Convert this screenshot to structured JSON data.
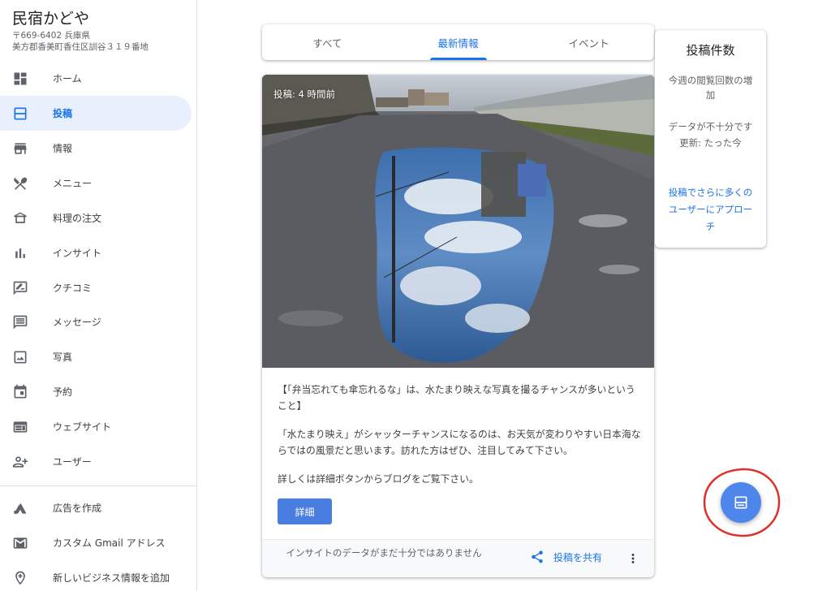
{
  "business": {
    "name": "民宿かどや",
    "address_line1": "〒669-6402 兵庫県",
    "address_line2": "美方郡香美町香住区訓谷３１９番地"
  },
  "sidebar": {
    "items": [
      {
        "label": "ホーム",
        "icon": "dashboard-icon"
      },
      {
        "label": "投稿",
        "icon": "post-icon",
        "active": true
      },
      {
        "label": "情報",
        "icon": "store-icon"
      },
      {
        "label": "メニュー",
        "icon": "utensils-icon"
      },
      {
        "label": "料理の注文",
        "icon": "food-order-icon"
      },
      {
        "label": "インサイト",
        "icon": "bar-chart-icon"
      },
      {
        "label": "クチコミ",
        "icon": "review-icon"
      },
      {
        "label": "メッセージ",
        "icon": "message-icon"
      },
      {
        "label": "写真",
        "icon": "photo-icon"
      },
      {
        "label": "予約",
        "icon": "calendar-icon"
      },
      {
        "label": "ウェブサイト",
        "icon": "website-icon"
      },
      {
        "label": "ユーザー",
        "icon": "add-user-icon"
      }
    ],
    "bottom_items": [
      {
        "label": "広告を作成",
        "icon": "ads-icon"
      },
      {
        "label": "カスタム Gmail アドレス",
        "icon": "gmail-icon"
      },
      {
        "label": "新しいビジネス情報を追加",
        "icon": "add-location-icon"
      }
    ]
  },
  "tabs": [
    "すべて",
    "最新情報",
    "イベント"
  ],
  "active_tab": "最新情報",
  "post": {
    "time_label": "投稿: 4 時間前",
    "paragraph1": "【「弁当忘れても傘忘れるな」は、水たまり映えな写真を撮るチャンスが多いということ】",
    "paragraph2": "「水たまり映え」がシャッターチャンスになるのは、お天気が変わりやすい日本海ならではの風景だと思います。訪れた方はぜひ、注目してみて下さい。",
    "paragraph3": "詳しくは詳細ボタンからブログをご覧下さい。",
    "detail_button": "詳細",
    "footer_note": "インサイトのデータがまだ十分ではありません",
    "share_label": "投稿を共有"
  },
  "stats": {
    "title": "投稿件数",
    "subtitle": "今週の閲覧回数の増加",
    "message": "データが不十分です",
    "updated": "更新: たった今",
    "link": "投稿でさらに多くのユーザーにアプローチ"
  },
  "colors": {
    "accent": "#1a73e8",
    "active_bg": "#e8f0fe",
    "button": "#4a7de0",
    "fab": "#4f86ec",
    "annotation_circle": "#e0302a"
  }
}
